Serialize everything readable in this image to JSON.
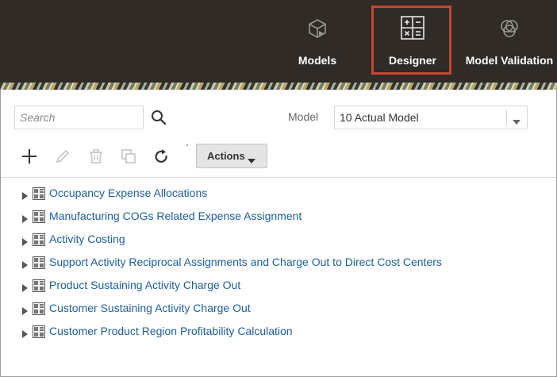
{
  "header": {
    "nav": [
      {
        "label": "Models",
        "icon": "cube-icon"
      },
      {
        "label": "Designer",
        "icon": "calculator-icon",
        "highlighted": true
      },
      {
        "label": "Model Validation",
        "icon": "overlapping-circles-icon"
      }
    ],
    "highlight_color": "#c74634"
  },
  "search": {
    "placeholder": "Search",
    "value": ""
  },
  "model": {
    "label": "Model",
    "selected": "10 Actual Model"
  },
  "toolbar": {
    "actions_label": "Actions"
  },
  "tree": {
    "items": [
      {
        "label": "Occupancy Expense Allocations"
      },
      {
        "label": "Manufacturing COGs Related Expense Assignment"
      },
      {
        "label": "Activity Costing"
      },
      {
        "label": "Support Activity Reciprocal Assignments and Charge Out to Direct Cost Centers"
      },
      {
        "label": "Product Sustaining Activity Charge Out"
      },
      {
        "label": "Customer Sustaining Activity Charge Out"
      },
      {
        "label": "Customer Product Region Profitability Calculation"
      }
    ]
  },
  "colors": {
    "header_bg": "#302b27",
    "link": "#1d5e9a"
  }
}
